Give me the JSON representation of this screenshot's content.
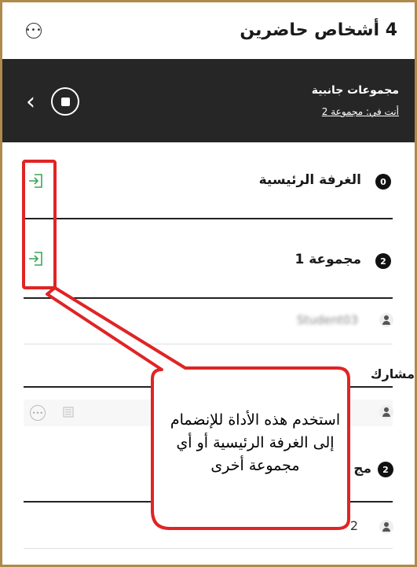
{
  "header": {
    "title": "4 أشخاص حاضرين",
    "more_icon": "more-options-icon"
  },
  "breakout": {
    "title": "مجموعات جانبية",
    "location": "أنت في: مجموعة 2"
  },
  "groups": [
    {
      "badge": "0",
      "label": "الغرفة الرئيسية"
    },
    {
      "badge": "2",
      "label": "مجموعة 1"
    }
  ],
  "members": [
    {
      "name": "Student03"
    }
  ],
  "section_label": "مشارك",
  "other_group": {
    "badge": "2",
    "label": "مج"
  },
  "last_member": {
    "name": "2"
  },
  "callout": {
    "line1": "استخدم هذه الأداة للإنضمام",
    "line2": "إلى الغرفة الرئيسية أو أي",
    "line3": "مجموعة أخرى"
  },
  "colors": {
    "dark_bar": "#262626",
    "join_icon": "#3aa655",
    "annotation": "#e02424",
    "frame": "#b08a4a"
  }
}
